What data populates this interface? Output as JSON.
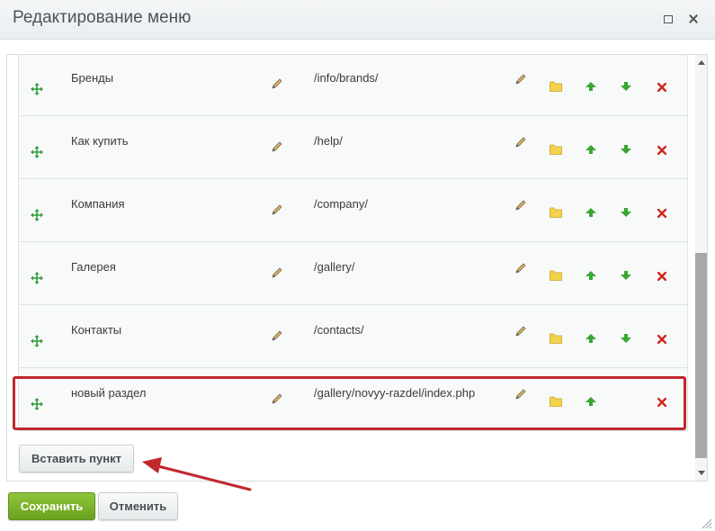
{
  "dialog": {
    "title": "Редактирование меню"
  },
  "menu_items": [
    {
      "name": "Бренды",
      "url": "/info/brands/",
      "can_move_up": true,
      "can_move_down": true
    },
    {
      "name": "Как купить",
      "url": "/help/",
      "can_move_up": true,
      "can_move_down": true
    },
    {
      "name": "Компания",
      "url": "/company/",
      "can_move_up": true,
      "can_move_down": true
    },
    {
      "name": "Галерея",
      "url": "/gallery/",
      "can_move_up": true,
      "can_move_down": true
    },
    {
      "name": "Контакты",
      "url": "/contacts/",
      "can_move_up": true,
      "can_move_down": true
    },
    {
      "name": "новый раздел",
      "url": "/gallery/novyy-razdel/index.php",
      "can_move_up": true,
      "can_move_down": false
    }
  ],
  "buttons": {
    "insert": "Вставить пункт",
    "save": "Сохранить",
    "cancel": "Отменить"
  },
  "icons": {
    "move": "move-arrows-icon",
    "edit": "pencil-icon",
    "folder": "folder-icon",
    "up": "arrow-up-icon",
    "down": "arrow-down-icon",
    "delete": "close-x-icon"
  },
  "colors": {
    "highlight": "#c0282d",
    "save_button": "#7ab42c",
    "move_icon": "#2e9e3a",
    "delete_icon": "#d0271f",
    "folder_icon": "#f3d34a"
  }
}
